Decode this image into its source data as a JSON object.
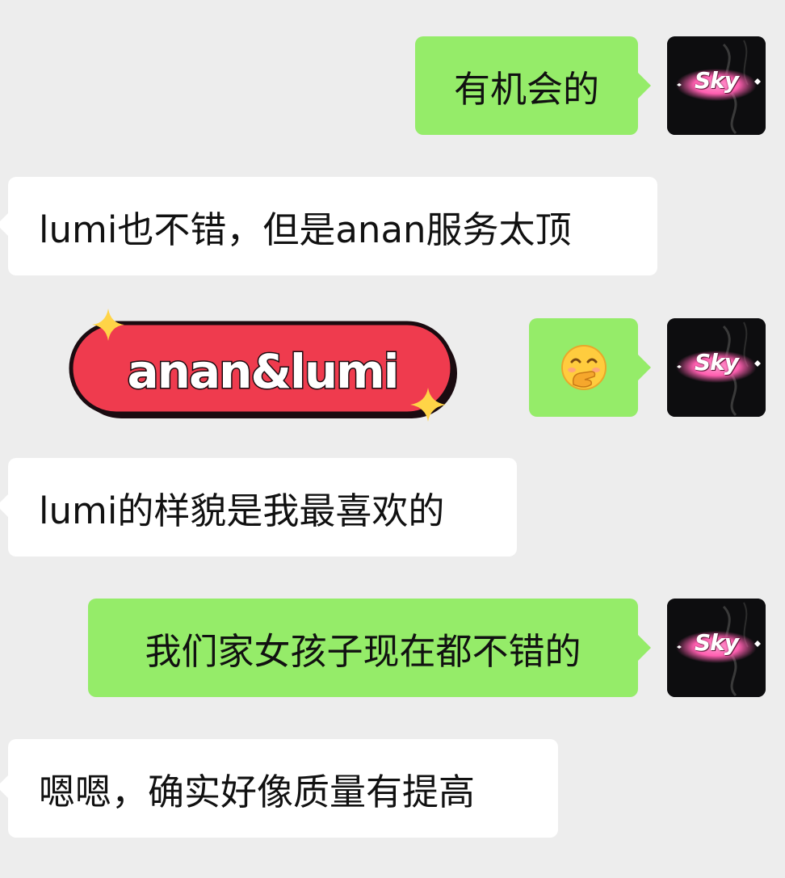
{
  "messages": [
    {
      "side": "out",
      "text": "有机会的"
    },
    {
      "side": "in",
      "text": "lumi也不错，但是anan服务太顶"
    },
    {
      "side": "in",
      "type": "sticker",
      "text": "anan&lumi"
    },
    {
      "side": "out",
      "type": "emoji",
      "emoji_name": "hand-over-mouth-emoji"
    },
    {
      "side": "in",
      "text": "lumi的样貌是我最喜欢的"
    },
    {
      "side": "out",
      "text": "我们家女孩子现在都不错的"
    },
    {
      "side": "in",
      "text": "嗯嗯，确实好像质量有提高"
    }
  ],
  "avatar": {
    "label": "Sky"
  },
  "colors": {
    "background": "#ededed",
    "outgoing_bubble": "#95ec69",
    "incoming_bubble": "#ffffff",
    "sticker_red": "#ef3b4e",
    "sparkle": "#ffd447",
    "avatar_glow": "#ff5fb0"
  }
}
